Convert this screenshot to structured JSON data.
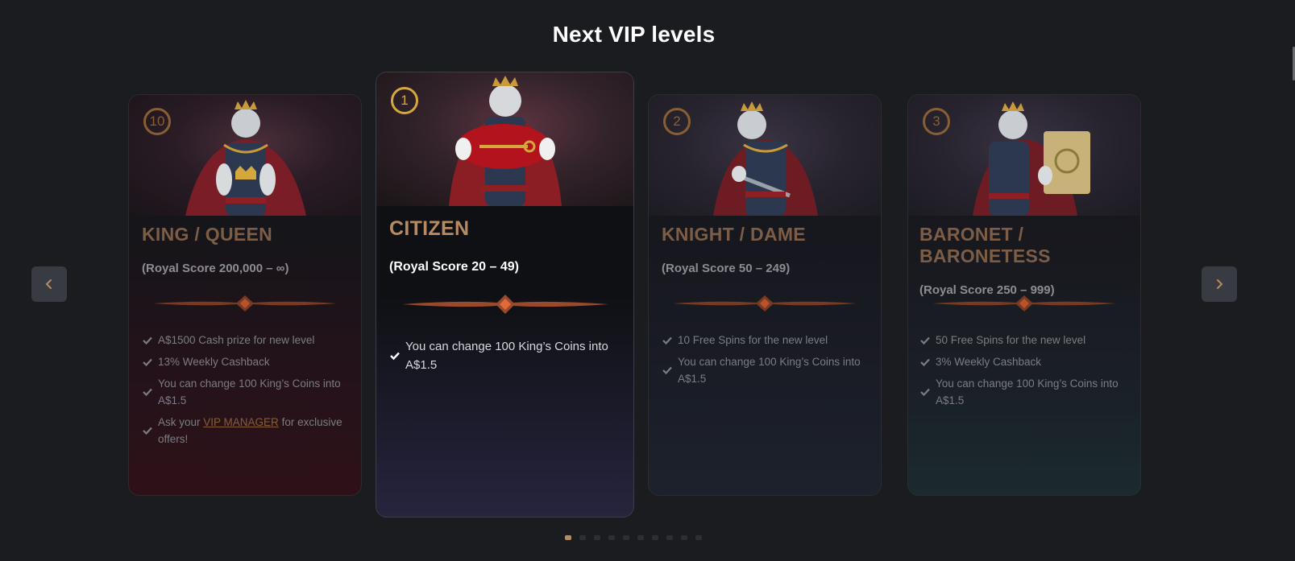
{
  "page": {
    "title": "Next VIP levels"
  },
  "nav": {
    "prev_icon": "chevron-left-icon",
    "next_icon": "chevron-right-icon"
  },
  "cards": [
    {
      "badge": "10",
      "name": "KING / QUEEN",
      "score": "(Royal Score 200,000 – ∞)",
      "benefits": [
        "A$1500 Cash prize for new level",
        "13% Weekly Cashback",
        "You can change 100 King’s Coins into A$1.5"
      ],
      "manager_prefix": "Ask your ",
      "manager_link": "VIP MANAGER",
      "manager_suffix": " for exclusive offers!"
    },
    {
      "badge": "1",
      "name": "CITIZEN",
      "score": "(Royal Score 20 – 49)",
      "benefits": [
        "You can change 100 King’s Coins into A$1.5"
      ]
    },
    {
      "badge": "2",
      "name": "KNIGHT / DAME",
      "score": "(Royal Score 50 – 249)",
      "benefits": [
        "10 Free Spins for the new level",
        "You can change 100 King’s Coins into A$1.5"
      ]
    },
    {
      "badge": "3",
      "name": "BARONET / BARONETESS",
      "score": "(Royal Score 250 – 999)",
      "benefits": [
        "50 Free Spins for the new level",
        "3% Weekly Cashback",
        "You can change 100 King’s Coins into A$1.5"
      ]
    }
  ],
  "pagination": {
    "total": 10,
    "active_index": 0
  },
  "colors": {
    "accent": "#b88a5f",
    "badge": "#8a5e34",
    "background": "#1b1c20"
  }
}
